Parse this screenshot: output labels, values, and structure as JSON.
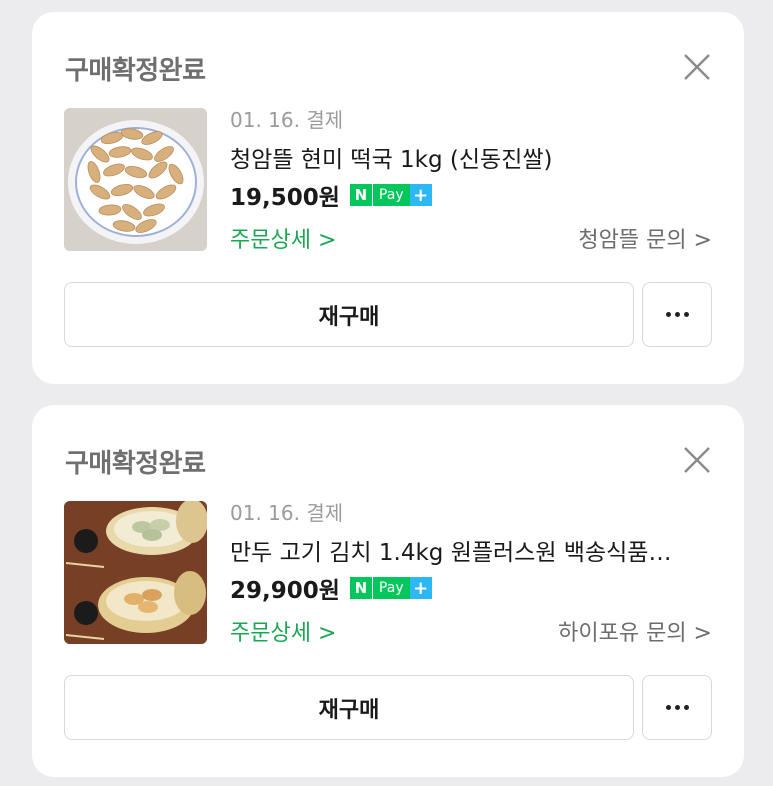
{
  "orders": [
    {
      "status": "구매확정완료",
      "date": "01. 16. 결제",
      "title": "청암뜰 현미 떡국 1kg (신동진쌀)",
      "price": "19,500원",
      "npay": {
        "n": "N",
        "pay": "Pay",
        "plus": "+"
      },
      "detail_link": "주문상세 >",
      "inquiry_link": "청암뜰 문의 >",
      "rebuy_label": "재구매",
      "thumbnail_icon": "rice-cake-photo"
    },
    {
      "status": "구매확정완료",
      "date": "01. 16. 결제",
      "title": "만두 고기 김치 1.4kg 원플러스원 백송식품…",
      "price": "29,900원",
      "npay": {
        "n": "N",
        "pay": "Pay",
        "plus": "+"
      },
      "detail_link": "주문상세 >",
      "inquiry_link": "하이포유 문의 >",
      "rebuy_label": "재구매",
      "thumbnail_icon": "dumpling-photo"
    }
  ],
  "colors": {
    "accent_green": "#19a852",
    "npay_green": "#03c75a",
    "npay_plus_blue": "#2db7f5"
  }
}
